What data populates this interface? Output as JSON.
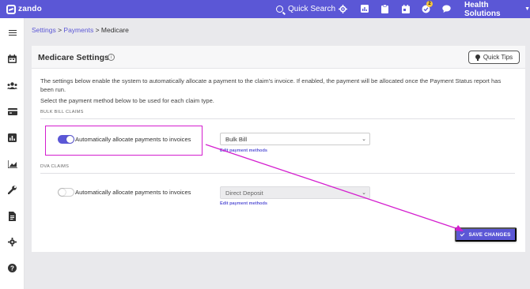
{
  "topbar": {
    "logo_text": "zando",
    "search_label": "Quick Search",
    "notification_count": "2",
    "org_name": "Health Solutions"
  },
  "icons": {
    "top": [
      "settings-icon",
      "reports-icon",
      "clipboard-icon",
      "calendar-icon",
      "tasks-icon",
      "chat-icon"
    ],
    "sidebar": [
      "menu-icon",
      "calendar-icon",
      "patients-icon",
      "billing-icon",
      "reports-icon",
      "analytics-icon",
      "tools-icon",
      "documents-icon",
      "settings-icon",
      "help-icon"
    ]
  },
  "breadcrumb": {
    "settings": "Settings",
    "sep1": " > ",
    "payments": "Payments",
    "sep2": " > ",
    "current": "Medicare"
  },
  "card": {
    "title": "Medicare Settings",
    "quick_tips": "Quick Tips",
    "description": "The settings below enable the system to automatically allocate a payment to the claim's invoice. If enabled, the payment will be allocated once the Payment Status report has been run.",
    "instruction": "Select the payment method below to be used for each claim type."
  },
  "sections": [
    {
      "label": "BULK BILL CLAIMS",
      "toggle_label": "Automatically allocate payments to invoices",
      "toggle_on": true,
      "method": "Bulk Bill",
      "edit_link": "Edit payment methods"
    },
    {
      "label": "DVA CLAIMS",
      "toggle_label": "Automatically allocate payments to invoices",
      "toggle_on": false,
      "method": "Direct Deposit",
      "edit_link": "Edit payment methods"
    }
  ],
  "save_button": "SAVE CHANGES",
  "colors": {
    "primary": "#5b57d6",
    "annotation": "#d41ecf"
  }
}
